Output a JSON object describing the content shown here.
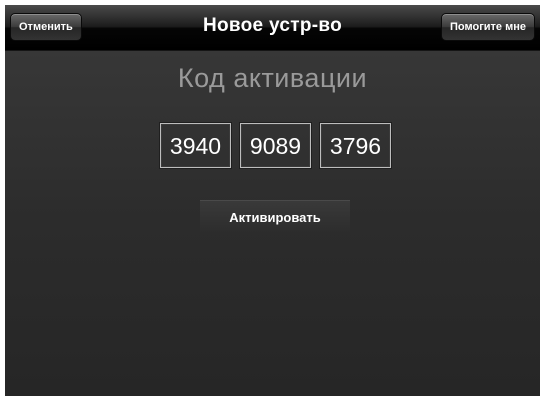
{
  "navbar": {
    "title": "Новое устр-во",
    "cancel_label": "Отменить",
    "help_label": "Помогите мне"
  },
  "main": {
    "heading": "Код активации",
    "code_parts": [
      "3940",
      "9089",
      "3796"
    ],
    "activate_label": "Активировать"
  }
}
